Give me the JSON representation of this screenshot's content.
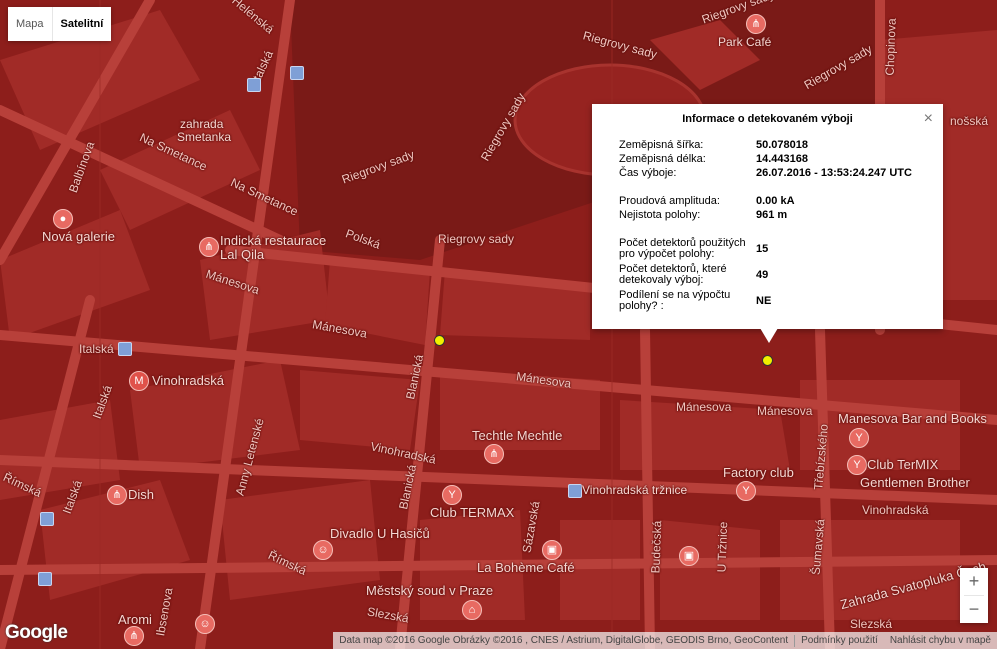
{
  "map_type_control": {
    "map_label": "Mapa",
    "satellite_label": "Satelitní",
    "active": "Satelitní"
  },
  "labels": {
    "helenska": "Helénská",
    "italska1": "Italská",
    "riegrovy_sady_top": "Riegrovy sady",
    "park_cafe": "Park Café",
    "riegrovy_sady_r1": "Riegrovy sady",
    "riegrovy_sady_r2": "Riegrovy sady",
    "riegrovy_sady_r3": "Riegrovy sady",
    "riegrovy_sady_mid": "Riegrovy sady",
    "zahrada_smetanka_1": "zahrada",
    "zahrada_smetanka_2": "Smetanka",
    "na_smetance_1": "Na Smetance",
    "na_smetance_2": "Na Smetance",
    "balbinova": "Balbínova",
    "nova_galerie": "Nová galerie",
    "indicka_1": "Indická restaurace",
    "indicka_2": "Lal Qila",
    "polska": "Polská",
    "manesova_1": "Mánesova",
    "manesova_2": "Mánesova",
    "manesova_3": "Mánesova",
    "manesova_4": "Mánesova",
    "manesova_5": "Mánesova",
    "italska2": "Italská",
    "italska3": "Italská",
    "italska4": "Italská",
    "vinohradska_poi": "Vinohradská",
    "blanicka1": "Blanická",
    "blanicka2": "Blanická",
    "techtle": "Techtle Mechtle",
    "vinohradska_street": "Vinohradská",
    "vinohradska_street2": "Vinohradská",
    "vinohradska_trznice": "Vinohradská tržnice",
    "factory_club": "Factory club",
    "manesova_bar": "Manesova Bar and Books",
    "club_termix": "Club TerMIX",
    "gentlemen": "Gentlemen Brother",
    "trebizska": "Třebízského",
    "rimska1": "Římská",
    "rimska2": "Římská",
    "dish": "Dish",
    "amerlet": "Anny Letenské",
    "club_termax": "Club TERMAX",
    "divadlo": "Divadlo U Hasičů",
    "sazavska": "Sázavská",
    "budecska": "Budečská",
    "u_trznice": "U Tržnice",
    "la_boheme": "La Bohème Café",
    "mestsky_soud": "Městský soud v Praze",
    "slezska1": "Slezská",
    "slezska2": "Slezská",
    "sumavska": "Šumavská",
    "zahrada_svatopluka": "Zahrada Svatopluka Čech",
    "aromi": "Aromi",
    "jecna": "Ibsenova",
    "chopinova": "Chopinova",
    "londynska": "nošská"
  },
  "info_window": {
    "title": "Informace o detekovaném výboji",
    "close_label": "×",
    "rows": [
      {
        "label": "Zeměpisná šířka:",
        "value": "50.078018"
      },
      {
        "label": "Zeměpisná délka:",
        "value": "14.443168"
      },
      {
        "label": "Čas výboje:",
        "value": "26.07.2016 - 13:53:24.247 UTC"
      },
      {
        "label": "Proudová amplituda:",
        "value": "0.00 kA"
      },
      {
        "label": "Nejistota polohy:",
        "value": "961 m"
      },
      {
        "label": "Počet detektorů použitých pro výpočet polohy:",
        "value": "15"
      },
      {
        "label": "Počet detektorů, které detekovaly výboj:",
        "value": "49"
      },
      {
        "label": "Podílení se na výpočtu polohy? :",
        "value": "NE"
      }
    ]
  },
  "zoom": {
    "in_label": "+",
    "out_label": "−"
  },
  "logo_text": "Google",
  "attribution": {
    "data_text": "Data map ©2016 Google Obrázky ©2016 , CNES / Astrium, DigitalGlobe, GEODIS Brno, GeoContent",
    "terms_text": "Podmínky použití",
    "report_text": "Nahlásit chybu v mapě"
  },
  "colors": {
    "overlay": "#8f1f1c",
    "marker": "#f0f000"
  }
}
